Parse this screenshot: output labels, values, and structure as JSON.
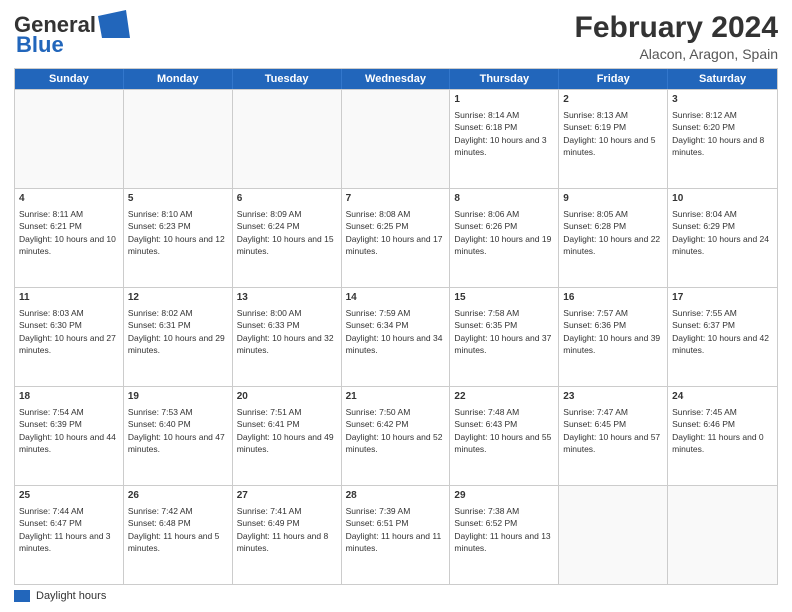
{
  "header": {
    "logo_line1": "General",
    "logo_line2": "Blue",
    "main_title": "February 2024",
    "subtitle": "Alacon, Aragon, Spain"
  },
  "days_of_week": [
    "Sunday",
    "Monday",
    "Tuesday",
    "Wednesday",
    "Thursday",
    "Friday",
    "Saturday"
  ],
  "weeks": [
    [
      {
        "day": "",
        "info": ""
      },
      {
        "day": "",
        "info": ""
      },
      {
        "day": "",
        "info": ""
      },
      {
        "day": "",
        "info": ""
      },
      {
        "day": "1",
        "info": "Sunrise: 8:14 AM\nSunset: 6:18 PM\nDaylight: 10 hours and 3 minutes."
      },
      {
        "day": "2",
        "info": "Sunrise: 8:13 AM\nSunset: 6:19 PM\nDaylight: 10 hours and 5 minutes."
      },
      {
        "day": "3",
        "info": "Sunrise: 8:12 AM\nSunset: 6:20 PM\nDaylight: 10 hours and 8 minutes."
      }
    ],
    [
      {
        "day": "4",
        "info": "Sunrise: 8:11 AM\nSunset: 6:21 PM\nDaylight: 10 hours and 10 minutes."
      },
      {
        "day": "5",
        "info": "Sunrise: 8:10 AM\nSunset: 6:23 PM\nDaylight: 10 hours and 12 minutes."
      },
      {
        "day": "6",
        "info": "Sunrise: 8:09 AM\nSunset: 6:24 PM\nDaylight: 10 hours and 15 minutes."
      },
      {
        "day": "7",
        "info": "Sunrise: 8:08 AM\nSunset: 6:25 PM\nDaylight: 10 hours and 17 minutes."
      },
      {
        "day": "8",
        "info": "Sunrise: 8:06 AM\nSunset: 6:26 PM\nDaylight: 10 hours and 19 minutes."
      },
      {
        "day": "9",
        "info": "Sunrise: 8:05 AM\nSunset: 6:28 PM\nDaylight: 10 hours and 22 minutes."
      },
      {
        "day": "10",
        "info": "Sunrise: 8:04 AM\nSunset: 6:29 PM\nDaylight: 10 hours and 24 minutes."
      }
    ],
    [
      {
        "day": "11",
        "info": "Sunrise: 8:03 AM\nSunset: 6:30 PM\nDaylight: 10 hours and 27 minutes."
      },
      {
        "day": "12",
        "info": "Sunrise: 8:02 AM\nSunset: 6:31 PM\nDaylight: 10 hours and 29 minutes."
      },
      {
        "day": "13",
        "info": "Sunrise: 8:00 AM\nSunset: 6:33 PM\nDaylight: 10 hours and 32 minutes."
      },
      {
        "day": "14",
        "info": "Sunrise: 7:59 AM\nSunset: 6:34 PM\nDaylight: 10 hours and 34 minutes."
      },
      {
        "day": "15",
        "info": "Sunrise: 7:58 AM\nSunset: 6:35 PM\nDaylight: 10 hours and 37 minutes."
      },
      {
        "day": "16",
        "info": "Sunrise: 7:57 AM\nSunset: 6:36 PM\nDaylight: 10 hours and 39 minutes."
      },
      {
        "day": "17",
        "info": "Sunrise: 7:55 AM\nSunset: 6:37 PM\nDaylight: 10 hours and 42 minutes."
      }
    ],
    [
      {
        "day": "18",
        "info": "Sunrise: 7:54 AM\nSunset: 6:39 PM\nDaylight: 10 hours and 44 minutes."
      },
      {
        "day": "19",
        "info": "Sunrise: 7:53 AM\nSunset: 6:40 PM\nDaylight: 10 hours and 47 minutes."
      },
      {
        "day": "20",
        "info": "Sunrise: 7:51 AM\nSunset: 6:41 PM\nDaylight: 10 hours and 49 minutes."
      },
      {
        "day": "21",
        "info": "Sunrise: 7:50 AM\nSunset: 6:42 PM\nDaylight: 10 hours and 52 minutes."
      },
      {
        "day": "22",
        "info": "Sunrise: 7:48 AM\nSunset: 6:43 PM\nDaylight: 10 hours and 55 minutes."
      },
      {
        "day": "23",
        "info": "Sunrise: 7:47 AM\nSunset: 6:45 PM\nDaylight: 10 hours and 57 minutes."
      },
      {
        "day": "24",
        "info": "Sunrise: 7:45 AM\nSunset: 6:46 PM\nDaylight: 11 hours and 0 minutes."
      }
    ],
    [
      {
        "day": "25",
        "info": "Sunrise: 7:44 AM\nSunset: 6:47 PM\nDaylight: 11 hours and 3 minutes."
      },
      {
        "day": "26",
        "info": "Sunrise: 7:42 AM\nSunset: 6:48 PM\nDaylight: 11 hours and 5 minutes."
      },
      {
        "day": "27",
        "info": "Sunrise: 7:41 AM\nSunset: 6:49 PM\nDaylight: 11 hours and 8 minutes."
      },
      {
        "day": "28",
        "info": "Sunrise: 7:39 AM\nSunset: 6:51 PM\nDaylight: 11 hours and 11 minutes."
      },
      {
        "day": "29",
        "info": "Sunrise: 7:38 AM\nSunset: 6:52 PM\nDaylight: 11 hours and 13 minutes."
      },
      {
        "day": "",
        "info": ""
      },
      {
        "day": "",
        "info": ""
      }
    ]
  ],
  "legend": {
    "label": "Daylight hours"
  }
}
